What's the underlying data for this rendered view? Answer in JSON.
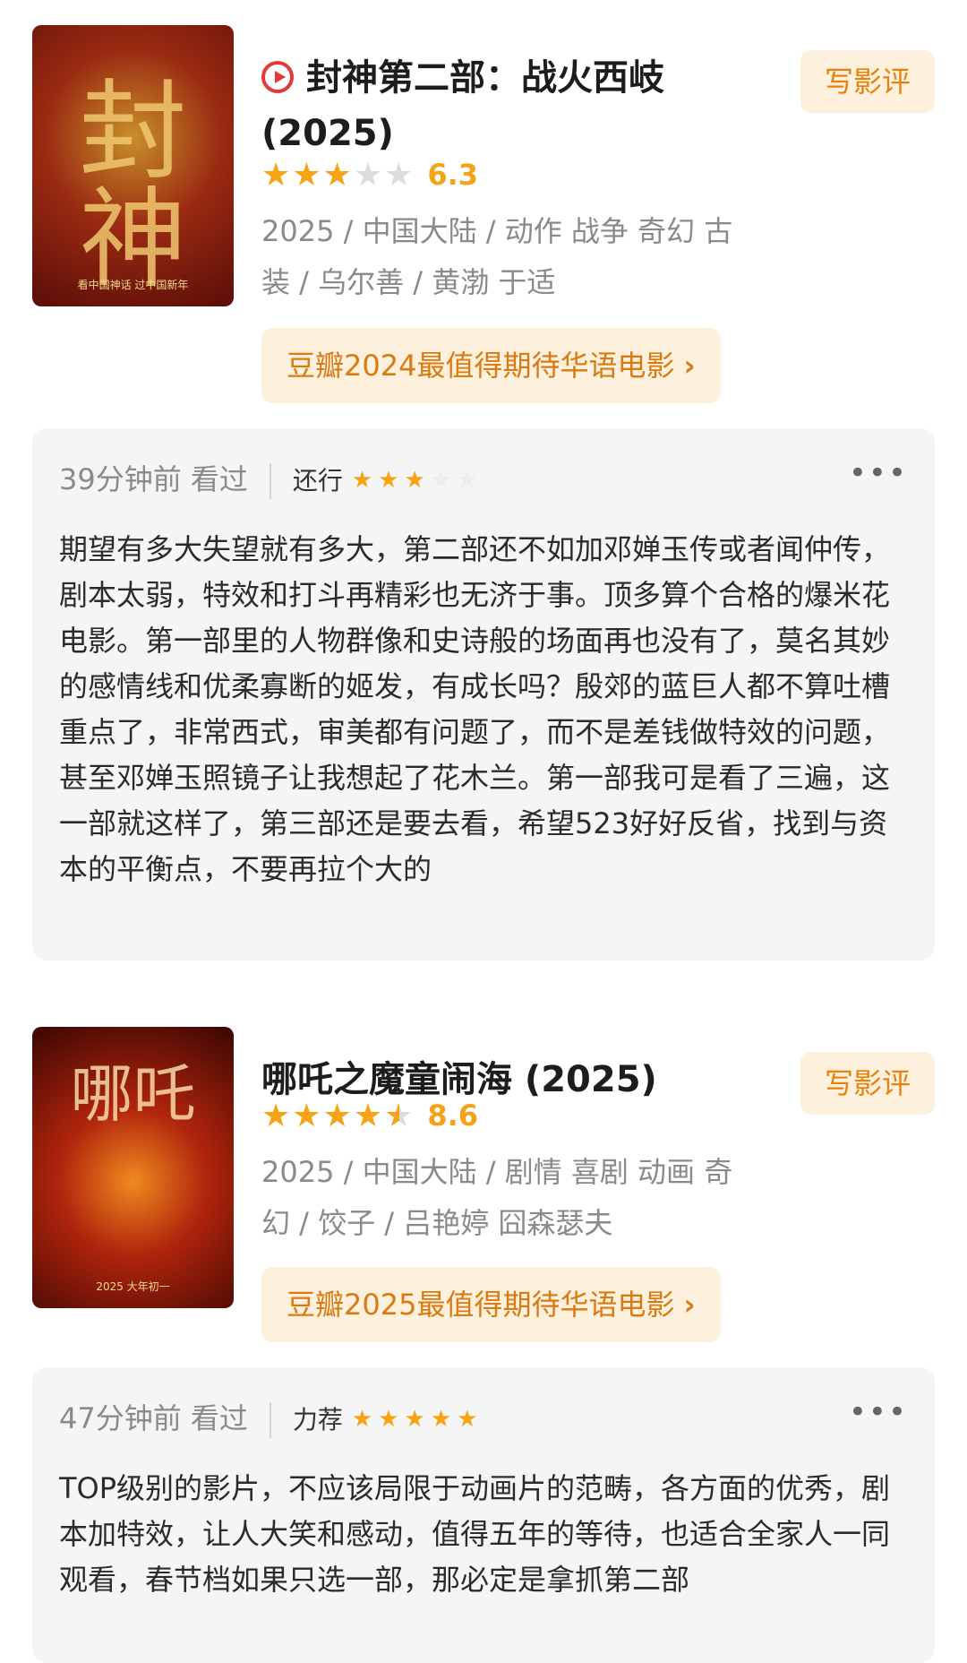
{
  "movies": [
    {
      "title": "封神第二部：战火西岐 (2025)",
      "poster_label": "封神",
      "poster_caption": "看中国神话 过中国新年",
      "write_review_label": "写影评",
      "score": "6.3",
      "stars": 3,
      "meta_line1": "2025 / 中国大陆 / 动作 战争 奇幻 古",
      "meta_line2": "装 / 乌尔善 / 黄渤 于适",
      "list_chip": "豆瓣2024最值得期待华语电影",
      "review": {
        "time": "39分钟前 看过",
        "verdict": "还行",
        "verdict_stars": 3,
        "more": "•••",
        "text": "期望有多大失望就有多大，第二部还不如加邓婵玉传或者闻仲传，剧本太弱，特效和打斗再精彩也无济于事。顶多算个合格的爆米花电影。第一部里的人物群像和史诗般的场面再也没有了，莫名其妙的感情线和优柔寡断的姬发，有成长吗？殷郊的蓝巨人都不算吐槽重点了，非常西式，审美都有问题了，而不是差钱做特效的问题，甚至邓婵玉照镜子让我想起了花木兰。第一部我可是看了三遍，这一部就这样了，第三部还是要去看，希望523好好反省，找到与资本的平衡点，不要再拉个大的"
      }
    },
    {
      "title": "哪吒之魔童闹海 (2025)",
      "poster_label": "哪吒",
      "poster_caption": "2025 大年初一",
      "write_review_label": "写影评",
      "score": "8.6",
      "stars": 4.5,
      "meta_line1": "2025 / 中国大陆 / 剧情 喜剧 动画 奇",
      "meta_line2": "幻 / 饺子 / 吕艳婷 囧森瑟夫",
      "list_chip": "豆瓣2025最值得期待华语电影",
      "review": {
        "time": "47分钟前 看过",
        "verdict": "力荐",
        "verdict_stars": 5,
        "more": "•••",
        "text": "TOP级别的影片，不应该局限于动画片的范畴，各方面的优秀，剧本加特效，让人大笑和感动，值得五年的等待，也适合全家人一同观看，春节档如果只选一部，那必定是拿抓第二部"
      }
    }
  ],
  "colors": {
    "accent": "#f6a416",
    "chip_bg": "#fdf0dc",
    "chip_text": "#d97a12",
    "play_red": "#e53935",
    "card_bg": "#f5f5f5"
  }
}
